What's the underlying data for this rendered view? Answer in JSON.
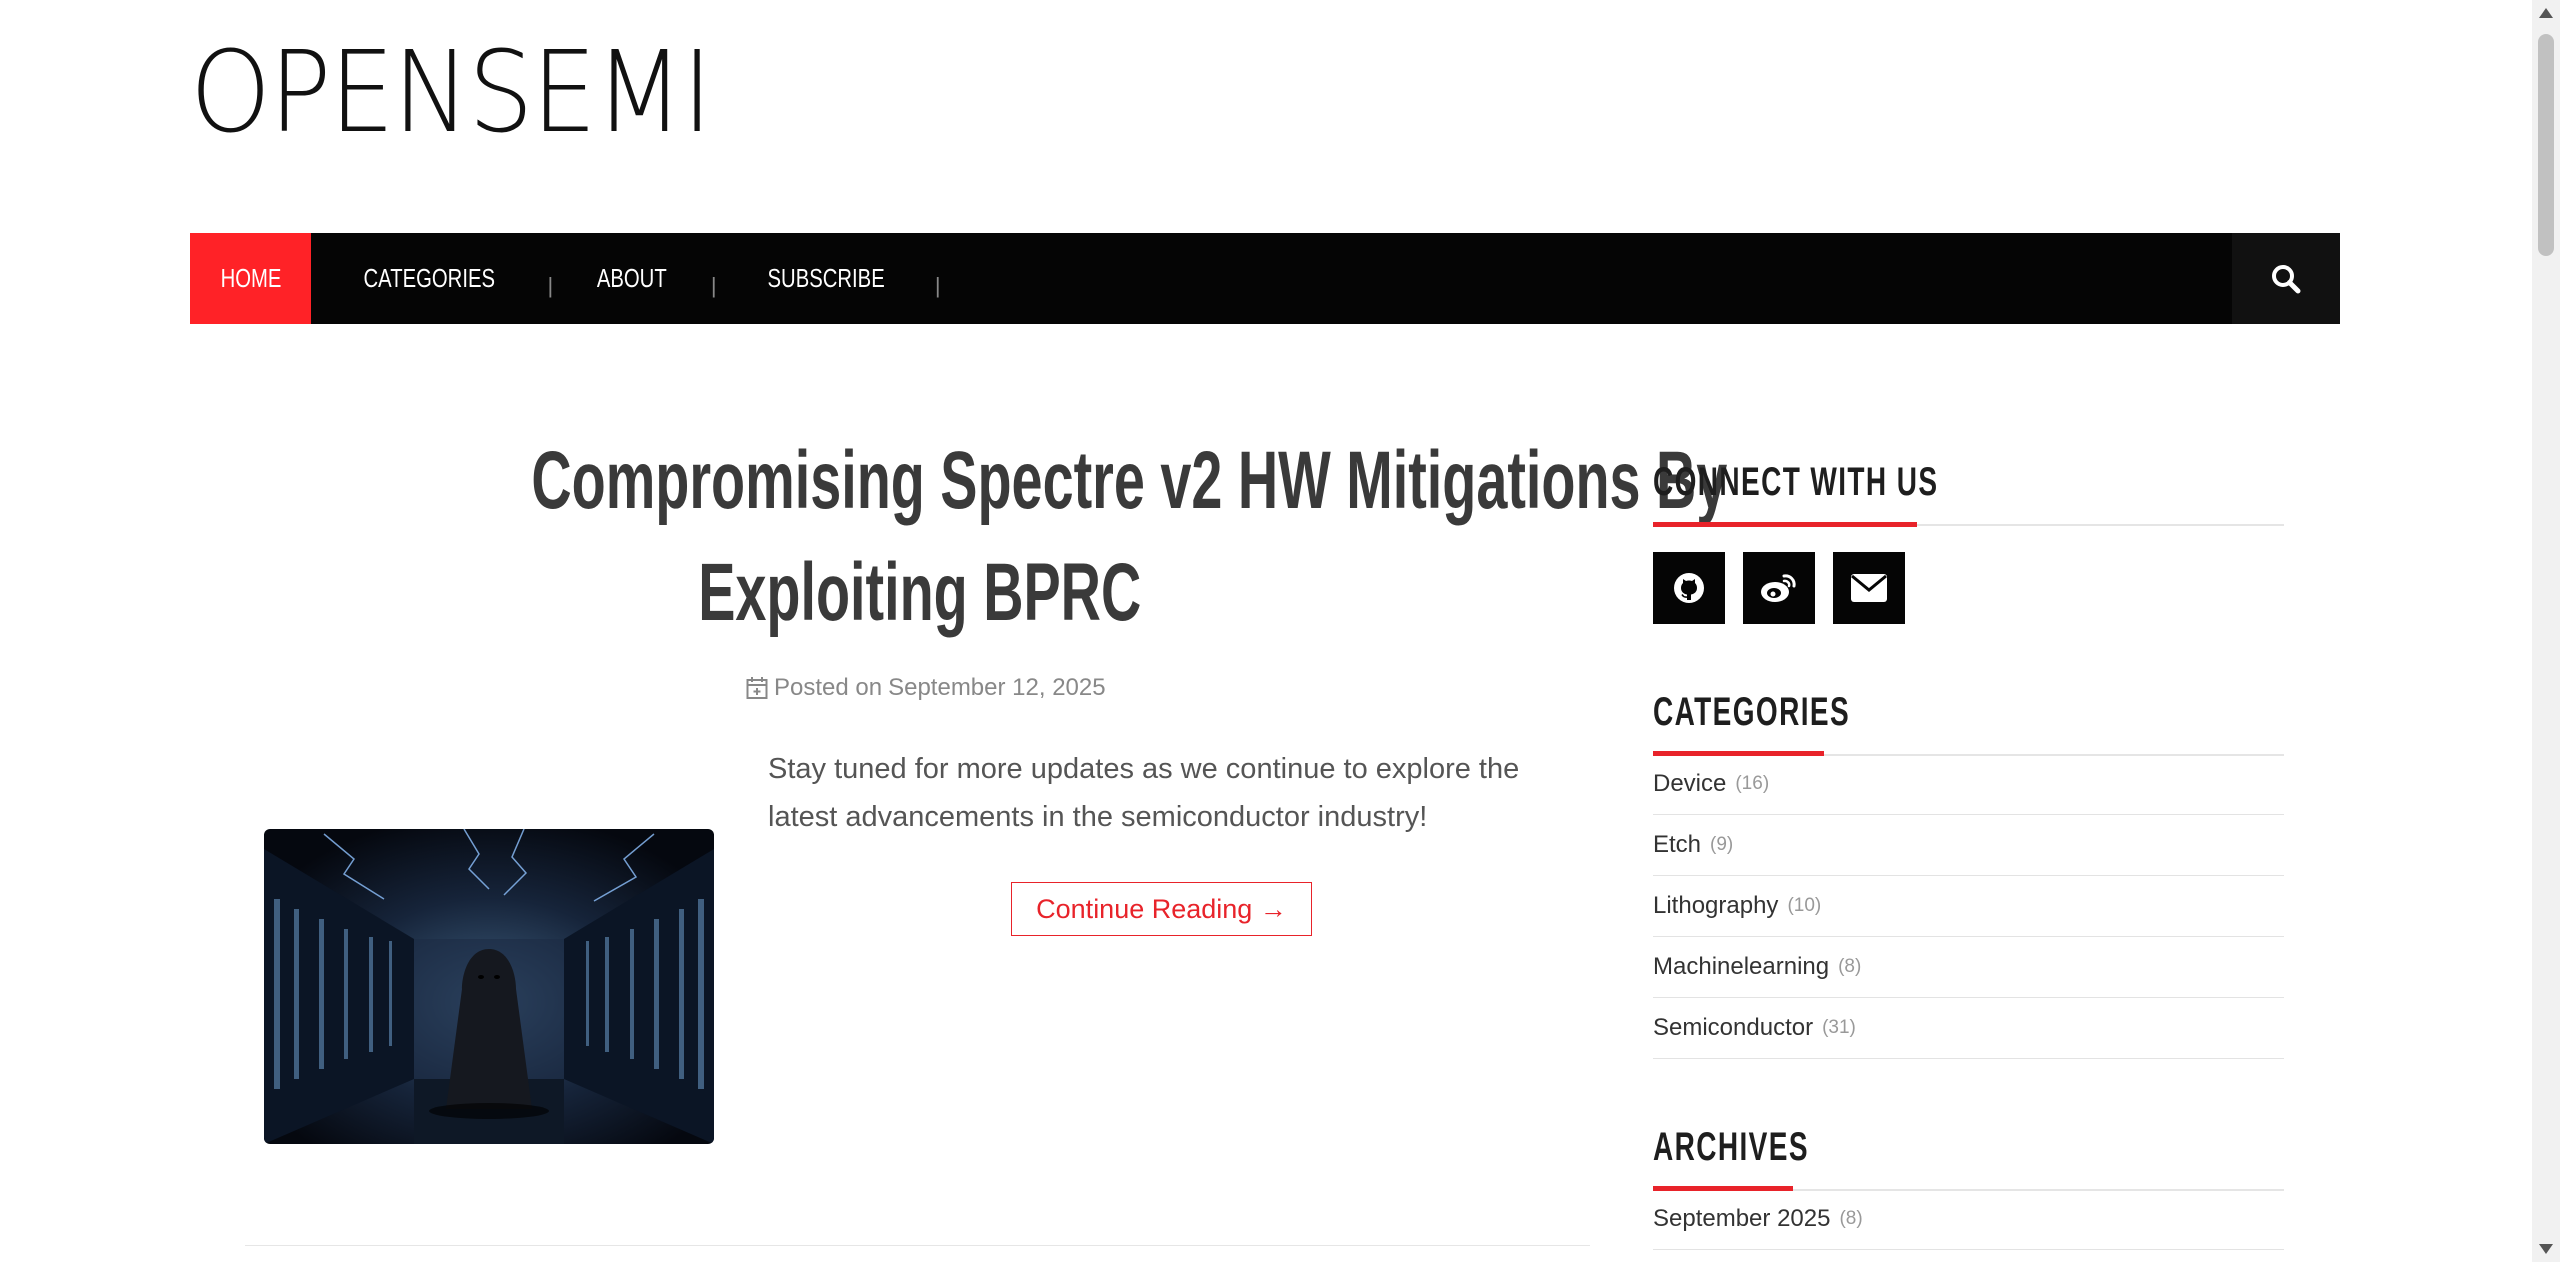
{
  "site": {
    "title": "OPENSEMI"
  },
  "nav": {
    "items": [
      {
        "label": "HOME",
        "active": true
      },
      {
        "label": "CATEGORIES"
      },
      {
        "label": "ABOUT"
      },
      {
        "label": "SUBSCRIBE"
      }
    ],
    "separator": "|",
    "search_icon": "search-icon"
  },
  "post": {
    "title_line1": "Compromising Spectre v2 HW Mitigations By",
    "title_line2": "Exploiting BPRC",
    "meta_prefix": "Posted on",
    "date": "September 12, 2025",
    "excerpt": "Stay tuned for more updates as we continue to explore the latest advancements in the semiconductor industry!",
    "continue_label": "Continue Reading →"
  },
  "sidebar": {
    "connect": {
      "title": "CONNECT WITH US",
      "icons": [
        "github-icon",
        "weibo-icon",
        "envelope-icon"
      ]
    },
    "categories": {
      "title": "CATEGORIES",
      "items": [
        {
          "name": "Device",
          "count": "(16)"
        },
        {
          "name": "Etch",
          "count": "(9)"
        },
        {
          "name": "Lithography",
          "count": "(10)"
        },
        {
          "name": "Machinelearning",
          "count": "(8)"
        },
        {
          "name": "Semiconductor",
          "count": "(31)"
        }
      ]
    },
    "archives": {
      "title": "ARCHIVES",
      "items": [
        {
          "name": "September 2025",
          "count": "(8)"
        }
      ]
    }
  },
  "colors": {
    "accent": "#e8232a",
    "nav_bg": "#050505",
    "active_nav": "#ff2227"
  }
}
